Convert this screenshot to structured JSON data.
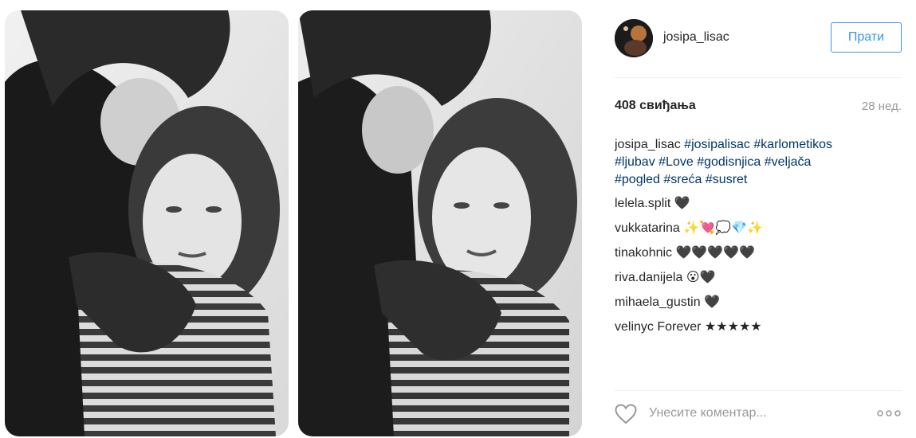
{
  "post": {
    "username": "josipa_lisac",
    "follow_label": "Прати",
    "likes": "408 свиђања",
    "time": "28 нед."
  },
  "caption": {
    "author": "josipa_lisac",
    "line1_tags": [
      "#josipalisac",
      "#karlometikos"
    ],
    "line2_tags": [
      "#ljubav",
      "#Love",
      "#godisnjica",
      "#veljača"
    ],
    "line3_tags": [
      "#pogled",
      "#sreća",
      "#susret"
    ]
  },
  "comments": [
    {
      "author": "lelela.split",
      "text": "🖤"
    },
    {
      "author": "vukkatarina",
      "text": "✨💘💭💎✨"
    },
    {
      "author": "tinakohnic",
      "text": "🖤🖤🖤🖤🖤"
    },
    {
      "author": "riva.danijela",
      "text": "😮🖤"
    },
    {
      "author": "mihaela_gustin",
      "text": "🖤"
    },
    {
      "author": "velinyc",
      "text": "Forever ★★★★★"
    }
  ],
  "comment_box": {
    "placeholder": "Унесите коментар..."
  },
  "icons": {
    "like": "heart-outline-icon",
    "more": "more-options-icon"
  },
  "colors": {
    "link": "#003569",
    "follow": "#3897f0",
    "muted": "#999999"
  }
}
